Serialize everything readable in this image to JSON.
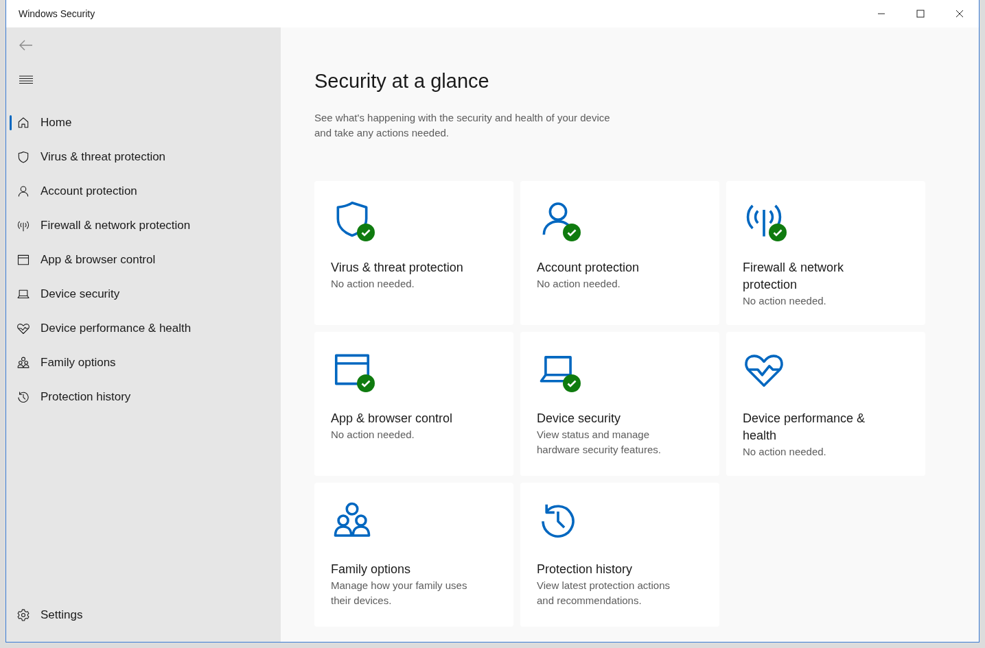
{
  "window": {
    "title": "Windows Security"
  },
  "sidebar": {
    "items": [
      {
        "label": "Home",
        "kind": "home",
        "selected": true
      },
      {
        "label": "Virus & threat protection",
        "kind": "shield",
        "selected": false
      },
      {
        "label": "Account protection",
        "kind": "person",
        "selected": false
      },
      {
        "label": "Firewall & network protection",
        "kind": "antenna",
        "selected": false
      },
      {
        "label": "App & browser control",
        "kind": "window",
        "selected": false
      },
      {
        "label": "Device security",
        "kind": "laptop",
        "selected": false
      },
      {
        "label": "Device performance & health",
        "kind": "heart",
        "selected": false
      },
      {
        "label": "Family options",
        "kind": "family",
        "selected": false
      },
      {
        "label": "Protection history",
        "kind": "history",
        "selected": false
      }
    ],
    "footer": {
      "label": "Settings",
      "kind": "gear"
    }
  },
  "main": {
    "title": "Security at a glance",
    "description": "See what's happening with the security and health of your device and take any actions needed.",
    "cards": [
      {
        "kind": "shield",
        "ok": true,
        "title": "Virus & threat protection",
        "subtitle": "No action needed."
      },
      {
        "kind": "person",
        "ok": true,
        "title": "Account protection",
        "subtitle": "No action needed."
      },
      {
        "kind": "antenna",
        "ok": true,
        "title": "Firewall & network protection",
        "subtitle": "No action needed."
      },
      {
        "kind": "window",
        "ok": true,
        "title": "App & browser control",
        "subtitle": "No action needed."
      },
      {
        "kind": "laptop",
        "ok": true,
        "title": "Device security",
        "subtitle": "View status and manage hardware security features."
      },
      {
        "kind": "heart",
        "ok": false,
        "title": "Device performance & health",
        "subtitle": "No action needed."
      },
      {
        "kind": "family",
        "ok": false,
        "title": "Family options",
        "subtitle": "Manage how your family uses their devices."
      },
      {
        "kind": "history",
        "ok": false,
        "title": "Protection history",
        "subtitle": "View latest protection actions and recommendations."
      }
    ]
  }
}
